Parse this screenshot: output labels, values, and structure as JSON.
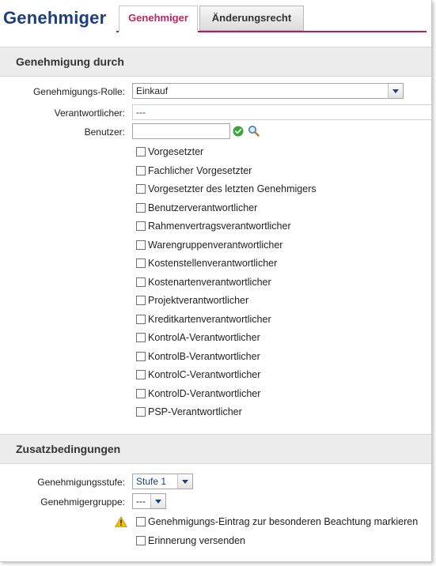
{
  "header": {
    "title": "Genehmiger"
  },
  "tabs": [
    {
      "label": "Genehmiger",
      "active": true
    },
    {
      "label": "Änderungsrecht",
      "active": false
    }
  ],
  "approval": {
    "heading": "Genehmigung durch",
    "role_label": "Genehmigungs-Rolle:",
    "role_value": "Einkauf",
    "responsible_label": "Verantwortlicher:",
    "responsible_value": "---",
    "user_label": "Benutzer:",
    "user_value": "",
    "options": [
      {
        "label": "Vorgesetzter",
        "checked": false
      },
      {
        "label": "Fachlicher Vorgesetzter",
        "checked": false
      },
      {
        "label": "Vorgesetzter des letzten Genehmigers",
        "checked": false
      },
      {
        "label": "Benutzerverantwortlicher",
        "checked": false
      },
      {
        "label": "Rahmenvertragsverantwortlicher",
        "checked": false
      },
      {
        "label": "Warengruppenverantwortlicher",
        "checked": false
      },
      {
        "label": "Kostenstellenverantwortlicher",
        "checked": false
      },
      {
        "label": "Kostenartenverantwortlicher",
        "checked": false
      },
      {
        "label": "Projektverantwortlicher",
        "checked": false
      },
      {
        "label": "Kreditkartenverantwortlicher",
        "checked": false
      },
      {
        "label": "KontrolA-Verantwortlicher",
        "checked": false
      },
      {
        "label": "KontrolB-Verantwortlicher",
        "checked": false
      },
      {
        "label": "KontrolC-Verantwortlicher",
        "checked": false
      },
      {
        "label": "KontrolD-Verantwortlicher",
        "checked": false
      },
      {
        "label": "PSP-Verantwortlicher",
        "checked": false
      }
    ]
  },
  "conditions": {
    "heading": "Zusatzbedingungen",
    "level_label": "Genehmigungsstufe:",
    "level_value": "Stufe 1",
    "group_label": "Genehmigergruppe:",
    "group_value": "---",
    "mark_label": "Genehmigungs-Eintrag zur besonderen Beachtung markieren",
    "mark_checked": false,
    "reminder_label": "Erinnerung versenden",
    "reminder_checked": false
  },
  "icons": {
    "ok": "check-circle-icon",
    "search": "magnifier-icon",
    "warning": "warning-triangle-icon"
  },
  "colors": {
    "title": "#1d3f7a",
    "accent": "#c0245f",
    "ok": "#3aa535",
    "warning": "#f2c200"
  }
}
